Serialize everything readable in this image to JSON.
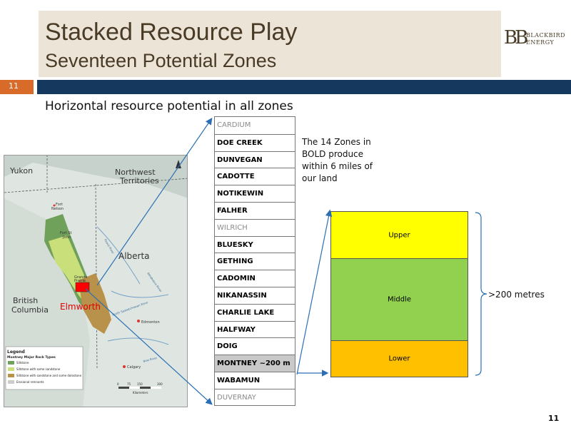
{
  "slide": {
    "title": "Stacked Resource Play",
    "subtitle": "Seventeen Potential Zones",
    "number_badge": "11",
    "page_number": "11",
    "heading": "Horizontal resource potential in all zones"
  },
  "logo": {
    "mark": "BB",
    "line1": "BLACKBIRD",
    "line2": "ENERGY"
  },
  "map": {
    "labels": {
      "yukon": "Yukon",
      "nwt_line1": "Northwest",
      "nwt_line2": "Territories",
      "fort_nelson_1": "Fort",
      "fort_nelson_2": "Nelson",
      "fort_st_john_1": "Fort St",
      "fort_st_john_2": "John",
      "alberta": "Alberta",
      "bc_line1": "British",
      "bc_line2": "Columbia",
      "elmworth": "Elmworth",
      "edmonton": "Edmonton",
      "calgary": "Calgary",
      "grande_prairie_1": "Grande",
      "grande_prairie_2": "Prairie",
      "peace_river": "Peace River",
      "athabasca_river": "Athabasca River",
      "north_sask_river": "North Saskatchewan River",
      "bow_river": "Bow River"
    },
    "legend": {
      "title": "Legend",
      "subtitle": "Montney Major Rock Types",
      "items": [
        {
          "label": "Siltstone",
          "color": "#6fa15a"
        },
        {
          "label": "Siltstone with some sandstone",
          "color": "#c9e07a"
        },
        {
          "label": "Siltstone with sandstone and some dolostone",
          "color": "#b8914a"
        },
        {
          "label": "Erosional remnants",
          "color": "#cccccc"
        }
      ]
    },
    "scale": {
      "ticks": [
        "0",
        "75",
        "150",
        "300"
      ],
      "unit": "Kilometers"
    }
  },
  "zones": [
    {
      "name": "CARDIUM",
      "style": "light"
    },
    {
      "name": "DOE CREEK",
      "style": "bold"
    },
    {
      "name": "DUNVEGAN",
      "style": "bold"
    },
    {
      "name": "CADOTTE",
      "style": "bold"
    },
    {
      "name": "NOTIKEWIN",
      "style": "bold"
    },
    {
      "name": "FALHER",
      "style": "bold"
    },
    {
      "name": "WILRICH",
      "style": "light"
    },
    {
      "name": "BLUESKY",
      "style": "bold"
    },
    {
      "name": "GETHING",
      "style": "bold"
    },
    {
      "name": "CADOMIN",
      "style": "bold"
    },
    {
      "name": "NIKANASSIN",
      "style": "bold"
    },
    {
      "name": "CHARLIE LAKE",
      "style": "bold"
    },
    {
      "name": "HALFWAY",
      "style": "bold"
    },
    {
      "name": "DOIG",
      "style": "bold"
    },
    {
      "name": "MONTNEY ~200 m",
      "style": "bold-hl"
    },
    {
      "name": "WABAMUN",
      "style": "bold"
    },
    {
      "name": "DUVERNAY",
      "style": "light"
    }
  ],
  "note": "The 14 Zones in BOLD produce within 6 miles of our land",
  "montney_column": {
    "upper": "Upper",
    "middle": "Middle",
    "lower": "Lower"
  },
  "thickness_label": ">200 metres",
  "colors": {
    "title_bg": "#ece4d7",
    "accent_orange": "#d86a2a",
    "navy_bar": "#15395e",
    "arrow_blue": "#2a6fb5",
    "upper": "#ffff00",
    "middle": "#92d050",
    "lower": "#ffc000",
    "elmworth_box": "#ff0000"
  }
}
